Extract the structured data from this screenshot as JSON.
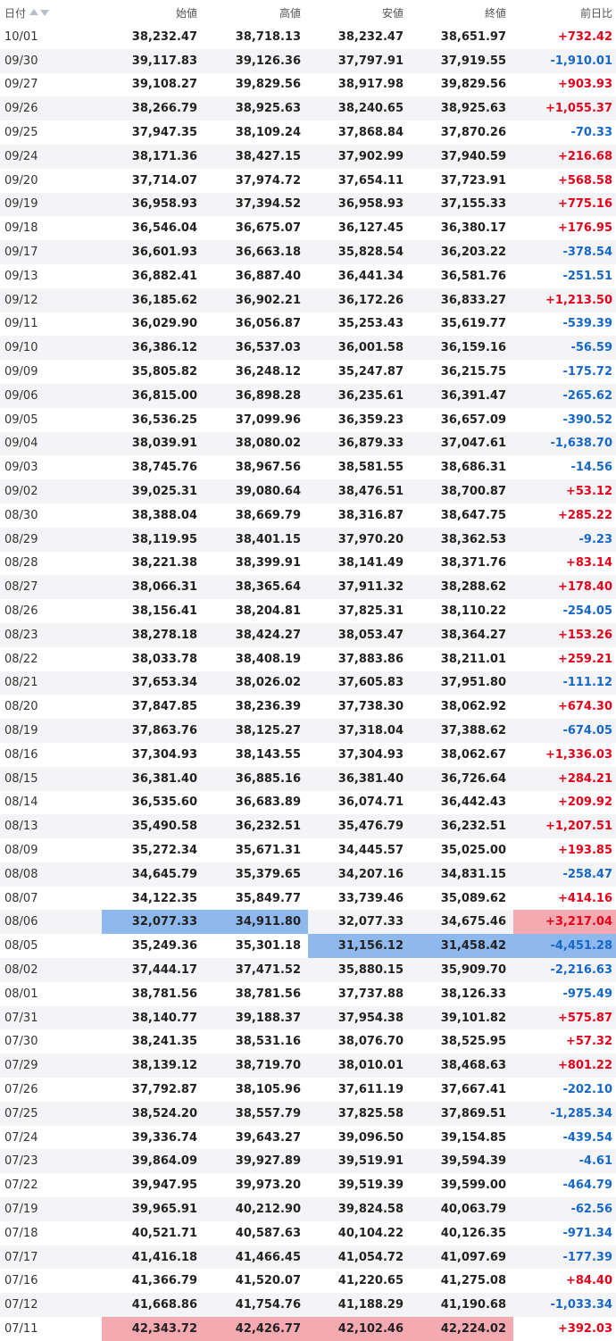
{
  "header": {
    "date": "日付",
    "open": "始値",
    "high": "高値",
    "low": "安値",
    "close": "終値",
    "change": "前日比"
  },
  "colors": {
    "up": "#e5001a",
    "down": "#1668c8",
    "highlight_low": "#8fb8ec",
    "highlight_high": "#f4aab0"
  },
  "rows": [
    {
      "date": "10/01",
      "open": "38,232.47",
      "high": "38,718.13",
      "low": "38,232.47",
      "close": "38,651.97",
      "change": "+732.42"
    },
    {
      "date": "09/30",
      "open": "39,117.83",
      "high": "39,126.36",
      "low": "37,797.91",
      "close": "37,919.55",
      "change": "-1,910.01"
    },
    {
      "date": "09/27",
      "open": "39,108.27",
      "high": "39,829.56",
      "low": "38,917.98",
      "close": "39,829.56",
      "change": "+903.93"
    },
    {
      "date": "09/26",
      "open": "38,266.79",
      "high": "38,925.63",
      "low": "38,240.65",
      "close": "38,925.63",
      "change": "+1,055.37"
    },
    {
      "date": "09/25",
      "open": "37,947.35",
      "high": "38,109.24",
      "low": "37,868.84",
      "close": "37,870.26",
      "change": "-70.33"
    },
    {
      "date": "09/24",
      "open": "38,171.36",
      "high": "38,427.15",
      "low": "37,902.99",
      "close": "37,940.59",
      "change": "+216.68"
    },
    {
      "date": "09/20",
      "open": "37,714.07",
      "high": "37,974.72",
      "low": "37,654.11",
      "close": "37,723.91",
      "change": "+568.58"
    },
    {
      "date": "09/19",
      "open": "36,958.93",
      "high": "37,394.52",
      "low": "36,958.93",
      "close": "37,155.33",
      "change": "+775.16"
    },
    {
      "date": "09/18",
      "open": "36,546.04",
      "high": "36,675.07",
      "low": "36,127.45",
      "close": "36,380.17",
      "change": "+176.95"
    },
    {
      "date": "09/17",
      "open": "36,601.93",
      "high": "36,663.18",
      "low": "35,828.54",
      "close": "36,203.22",
      "change": "-378.54"
    },
    {
      "date": "09/13",
      "open": "36,882.41",
      "high": "36,887.40",
      "low": "36,441.34",
      "close": "36,581.76",
      "change": "-251.51"
    },
    {
      "date": "09/12",
      "open": "36,185.62",
      "high": "36,902.21",
      "low": "36,172.26",
      "close": "36,833.27",
      "change": "+1,213.50"
    },
    {
      "date": "09/11",
      "open": "36,029.90",
      "high": "36,056.87",
      "low": "35,253.43",
      "close": "35,619.77",
      "change": "-539.39"
    },
    {
      "date": "09/10",
      "open": "36,386.12",
      "high": "36,537.03",
      "low": "36,001.58",
      "close": "36,159.16",
      "change": "-56.59"
    },
    {
      "date": "09/09",
      "open": "35,805.82",
      "high": "36,248.12",
      "low": "35,247.87",
      "close": "36,215.75",
      "change": "-175.72"
    },
    {
      "date": "09/06",
      "open": "36,815.00",
      "high": "36,898.28",
      "low": "36,235.61",
      "close": "36,391.47",
      "change": "-265.62"
    },
    {
      "date": "09/05",
      "open": "36,536.25",
      "high": "37,099.96",
      "low": "36,359.23",
      "close": "36,657.09",
      "change": "-390.52"
    },
    {
      "date": "09/04",
      "open": "38,039.91",
      "high": "38,080.02",
      "low": "36,879.33",
      "close": "37,047.61",
      "change": "-1,638.70"
    },
    {
      "date": "09/03",
      "open": "38,745.76",
      "high": "38,967.56",
      "low": "38,581.55",
      "close": "38,686.31",
      "change": "-14.56"
    },
    {
      "date": "09/02",
      "open": "39,025.31",
      "high": "39,080.64",
      "low": "38,476.51",
      "close": "38,700.87",
      "change": "+53.12"
    },
    {
      "date": "08/30",
      "open": "38,388.04",
      "high": "38,669.79",
      "low": "38,316.87",
      "close": "38,647.75",
      "change": "+285.22"
    },
    {
      "date": "08/29",
      "open": "38,119.95",
      "high": "38,401.15",
      "low": "37,970.20",
      "close": "38,362.53",
      "change": "-9.23"
    },
    {
      "date": "08/28",
      "open": "38,221.38",
      "high": "38,399.91",
      "low": "38,141.49",
      "close": "38,371.76",
      "change": "+83.14"
    },
    {
      "date": "08/27",
      "open": "38,066.31",
      "high": "38,365.64",
      "low": "37,911.32",
      "close": "38,288.62",
      "change": "+178.40"
    },
    {
      "date": "08/26",
      "open": "38,156.41",
      "high": "38,204.81",
      "low": "37,825.31",
      "close": "38,110.22",
      "change": "-254.05"
    },
    {
      "date": "08/23",
      "open": "38,278.18",
      "high": "38,424.27",
      "low": "38,053.47",
      "close": "38,364.27",
      "change": "+153.26"
    },
    {
      "date": "08/22",
      "open": "38,033.78",
      "high": "38,408.19",
      "low": "37,883.86",
      "close": "38,211.01",
      "change": "+259.21"
    },
    {
      "date": "08/21",
      "open": "37,653.34",
      "high": "38,026.02",
      "low": "37,605.83",
      "close": "37,951.80",
      "change": "-111.12"
    },
    {
      "date": "08/20",
      "open": "37,847.85",
      "high": "38,236.39",
      "low": "37,738.30",
      "close": "38,062.92",
      "change": "+674.30"
    },
    {
      "date": "08/19",
      "open": "37,863.76",
      "high": "38,125.27",
      "low": "37,318.04",
      "close": "37,388.62",
      "change": "-674.05"
    },
    {
      "date": "08/16",
      "open": "37,304.93",
      "high": "38,143.55",
      "low": "37,304.93",
      "close": "38,062.67",
      "change": "+1,336.03"
    },
    {
      "date": "08/15",
      "open": "36,381.40",
      "high": "36,885.16",
      "low": "36,381.40",
      "close": "36,726.64",
      "change": "+284.21"
    },
    {
      "date": "08/14",
      "open": "36,535.60",
      "high": "36,683.89",
      "low": "36,074.71",
      "close": "36,442.43",
      "change": "+209.92"
    },
    {
      "date": "08/13",
      "open": "35,490.58",
      "high": "36,232.51",
      "low": "35,476.79",
      "close": "36,232.51",
      "change": "+1,207.51"
    },
    {
      "date": "08/09",
      "open": "35,272.34",
      "high": "35,671.31",
      "low": "34,445.57",
      "close": "35,025.00",
      "change": "+193.85"
    },
    {
      "date": "08/08",
      "open": "34,645.79",
      "high": "35,379.65",
      "low": "34,207.16",
      "close": "34,831.15",
      "change": "-258.47"
    },
    {
      "date": "08/07",
      "open": "34,122.35",
      "high": "35,849.77",
      "low": "33,739.46",
      "close": "35,089.62",
      "change": "+414.16"
    },
    {
      "date": "08/06",
      "open": "32,077.33",
      "high": "34,911.80",
      "low": "32,077.33",
      "close": "34,675.46",
      "change": "+3,217.04",
      "hl": {
        "open": "blue",
        "high": "blue",
        "change": "red"
      }
    },
    {
      "date": "08/05",
      "open": "35,249.36",
      "high": "35,301.18",
      "low": "31,156.12",
      "close": "31,458.42",
      "change": "-4,451.28",
      "hl": {
        "low": "blue",
        "close": "blue",
        "change": "blue"
      }
    },
    {
      "date": "08/02",
      "open": "37,444.17",
      "high": "37,471.52",
      "low": "35,880.15",
      "close": "35,909.70",
      "change": "-2,216.63"
    },
    {
      "date": "08/01",
      "open": "38,781.56",
      "high": "38,781.56",
      "low": "37,737.88",
      "close": "38,126.33",
      "change": "-975.49"
    },
    {
      "date": "07/31",
      "open": "38,140.77",
      "high": "39,188.37",
      "low": "37,954.38",
      "close": "39,101.82",
      "change": "+575.87"
    },
    {
      "date": "07/30",
      "open": "38,241.35",
      "high": "38,531.16",
      "low": "38,076.70",
      "close": "38,525.95",
      "change": "+57.32"
    },
    {
      "date": "07/29",
      "open": "38,139.12",
      "high": "38,719.70",
      "low": "38,010.01",
      "close": "38,468.63",
      "change": "+801.22"
    },
    {
      "date": "07/26",
      "open": "37,792.87",
      "high": "38,105.96",
      "low": "37,611.19",
      "close": "37,667.41",
      "change": "-202.10"
    },
    {
      "date": "07/25",
      "open": "38,524.20",
      "high": "38,557.79",
      "low": "37,825.58",
      "close": "37,869.51",
      "change": "-1,285.34"
    },
    {
      "date": "07/24",
      "open": "39,336.74",
      "high": "39,643.27",
      "low": "39,096.50",
      "close": "39,154.85",
      "change": "-439.54"
    },
    {
      "date": "07/23",
      "open": "39,864.09",
      "high": "39,927.89",
      "low": "39,519.91",
      "close": "39,594.39",
      "change": "-4.61"
    },
    {
      "date": "07/22",
      "open": "39,947.95",
      "high": "39,973.20",
      "low": "39,519.39",
      "close": "39,599.00",
      "change": "-464.79"
    },
    {
      "date": "07/19",
      "open": "39,965.91",
      "high": "40,212.90",
      "low": "39,824.58",
      "close": "40,063.79",
      "change": "-62.56"
    },
    {
      "date": "07/18",
      "open": "40,521.71",
      "high": "40,587.63",
      "low": "40,104.22",
      "close": "40,126.35",
      "change": "-971.34"
    },
    {
      "date": "07/17",
      "open": "41,416.18",
      "high": "41,466.45",
      "low": "41,054.72",
      "close": "41,097.69",
      "change": "-177.39"
    },
    {
      "date": "07/16",
      "open": "41,366.79",
      "high": "41,520.07",
      "low": "41,220.65",
      "close": "41,275.08",
      "change": "+84.40"
    },
    {
      "date": "07/12",
      "open": "41,668.86",
      "high": "41,754.76",
      "low": "41,188.29",
      "close": "41,190.68",
      "change": "-1,033.34"
    },
    {
      "date": "07/11",
      "open": "42,343.72",
      "high": "42,426.77",
      "low": "42,102.46",
      "close": "42,224.02",
      "change": "+392.03",
      "hl": {
        "open": "red",
        "high": "red",
        "low": "red",
        "close": "red"
      }
    }
  ]
}
